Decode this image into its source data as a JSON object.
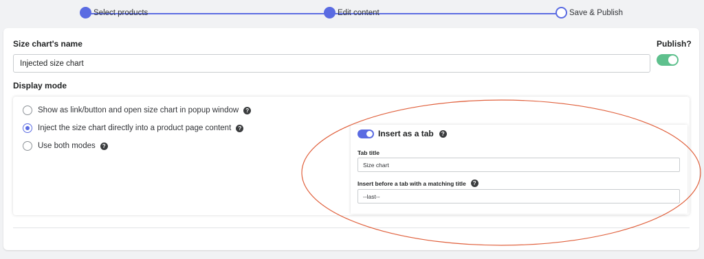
{
  "stepper": {
    "steps": [
      {
        "label": "Select products",
        "state": "done"
      },
      {
        "label": "Edit content",
        "state": "done"
      },
      {
        "label": "Save & Publish",
        "state": "pending"
      }
    ],
    "accent_color": "#5a6be2"
  },
  "form": {
    "name_label": "Size chart's name",
    "name_value": "Injected size chart",
    "publish_label": "Publish?",
    "publish_on": true,
    "display_mode_label": "Display mode",
    "display_options": [
      {
        "label": "Show as link/button and open size chart in popup window",
        "checked": false
      },
      {
        "label": "Inject the size chart directly into a product page content",
        "checked": true
      },
      {
        "label": "Use both modes",
        "checked": false
      }
    ],
    "help_glyph": "?"
  },
  "insert_tab": {
    "toggle_label": "Insert as a tab",
    "toggle_on": true,
    "tab_title_label": "Tab title",
    "tab_title_value": "Size chart",
    "insert_before_label": "Insert before a tab with a matching title",
    "insert_before_value": "--last--"
  },
  "colors": {
    "publish_toggle": "#5ec08d",
    "insert_toggle": "#5a6be2",
    "annotation_ellipse": "#e0603c"
  }
}
